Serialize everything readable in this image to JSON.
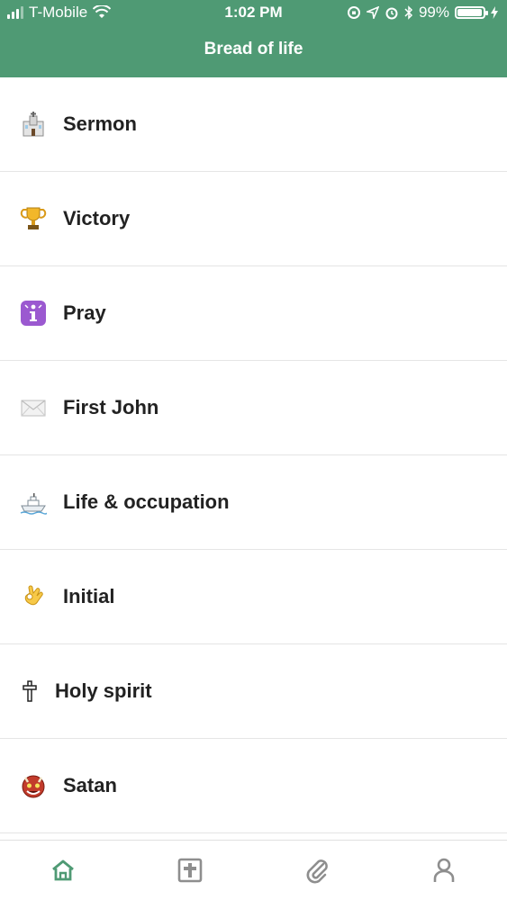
{
  "status_bar": {
    "carrier": "T-Mobile",
    "time": "1:02 PM",
    "battery_percent": "99%"
  },
  "header": {
    "title": "Bread of life"
  },
  "list": {
    "items": [
      {
        "label": "Sermon",
        "icon": "church-icon"
      },
      {
        "label": "Victory",
        "icon": "trophy-icon"
      },
      {
        "label": "Pray",
        "icon": "information-icon"
      },
      {
        "label": "First John",
        "icon": "envelope-icon"
      },
      {
        "label": "Life & occupation",
        "icon": "ship-icon"
      },
      {
        "label": "Initial",
        "icon": "ok-hand-icon"
      },
      {
        "label": "Holy spirit",
        "icon": "cross-icon"
      },
      {
        "label": "Satan",
        "icon": "demon-mask-icon"
      }
    ]
  },
  "tabbar": {
    "tabs": [
      {
        "icon": "home-icon",
        "active": true
      },
      {
        "icon": "bible-icon",
        "active": false
      },
      {
        "icon": "paperclip-icon",
        "active": false
      },
      {
        "icon": "profile-icon",
        "active": false
      }
    ]
  },
  "colors": {
    "header_bg": "#4f9a74",
    "active_tab": "#4f9a74",
    "inactive_tab": "#8e8e8e",
    "label": "#222222",
    "divider": "#e5e5e5"
  }
}
